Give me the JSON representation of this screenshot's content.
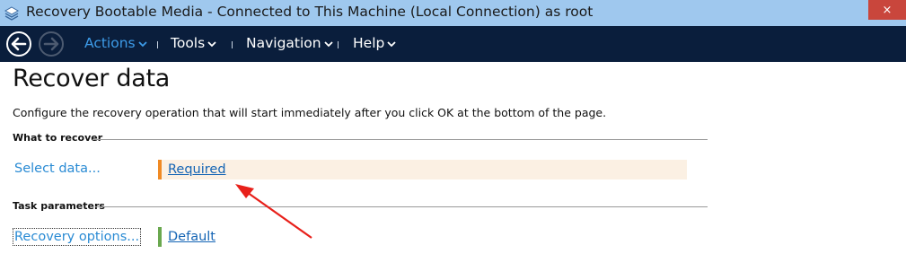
{
  "window": {
    "title": "Recovery Bootable Media - Connected to This Machine (Local Connection) as root",
    "close_glyph": "×"
  },
  "menubar": {
    "items": [
      {
        "label": "Actions",
        "active": true
      },
      {
        "label": "Tools",
        "active": false
      },
      {
        "label": "Navigation",
        "active": false
      },
      {
        "label": "Help",
        "active": false
      }
    ]
  },
  "page": {
    "title": "Recover data",
    "description": "Configure the recovery operation that will start immediately after you click OK at the bottom of the page."
  },
  "sections": {
    "what_to_recover": {
      "header": "What to recover",
      "rows": [
        {
          "label": "Select data...",
          "value": "Required",
          "status_color": "#f08a24"
        }
      ]
    },
    "task_parameters": {
      "header": "Task parameters",
      "rows": [
        {
          "label": "Recovery options...",
          "value": "Default",
          "status_color": "#6aa84f"
        }
      ]
    }
  },
  "colors": {
    "titlebar": "#9fc8ee",
    "menubar": "#0a1e3c",
    "accent": "#2a8bd4",
    "required_bg": "#fbf0e3",
    "annotation_arrow": "#e8201a"
  }
}
